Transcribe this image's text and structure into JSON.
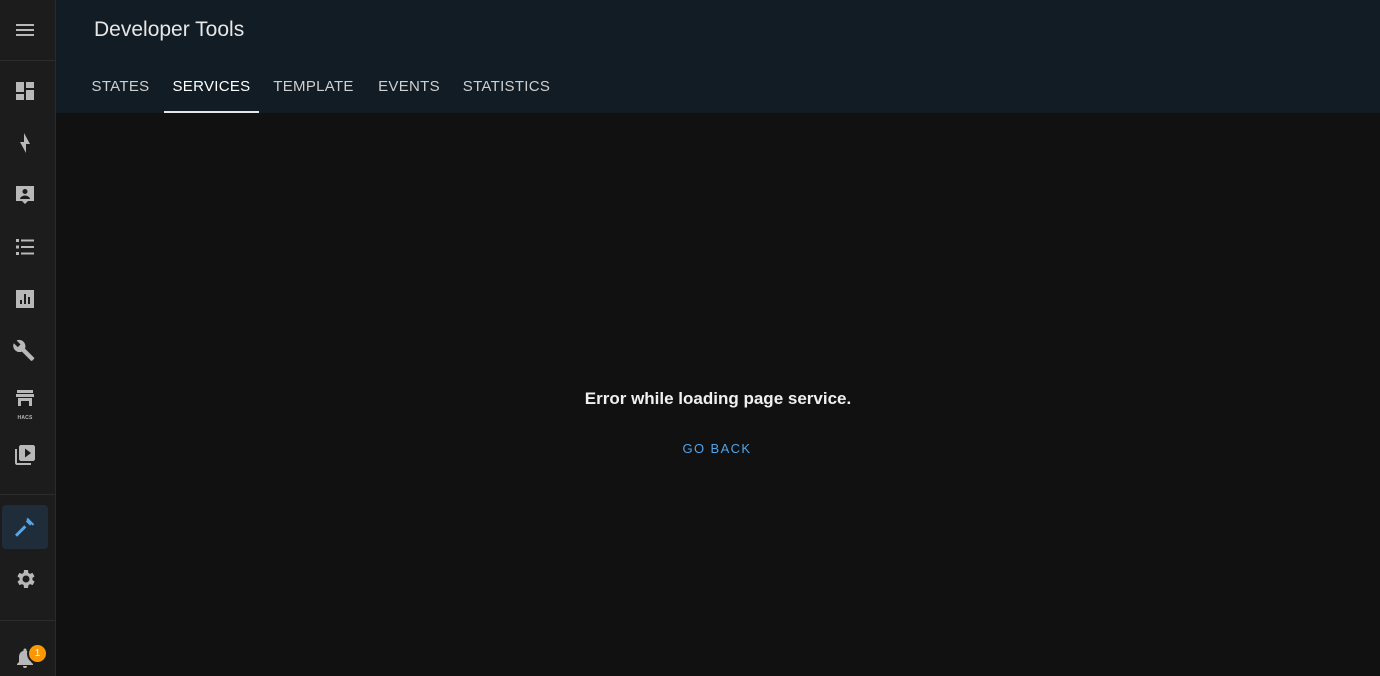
{
  "header": {
    "title": "Developer Tools"
  },
  "tabs": [
    {
      "label": "STATES",
      "active": false
    },
    {
      "label": "SERVICES",
      "active": true
    },
    {
      "label": "TEMPLATE",
      "active": false
    },
    {
      "label": "EVENTS",
      "active": false
    },
    {
      "label": "STATISTICS",
      "active": false
    }
  ],
  "sidebar": {
    "items": [
      {
        "icon": "menu-icon"
      },
      {
        "icon": "dashboard-icon"
      },
      {
        "icon": "lightning-icon"
      },
      {
        "icon": "logbook-icon"
      },
      {
        "icon": "list-icon"
      },
      {
        "icon": "history-chart-icon"
      },
      {
        "icon": "wrench-icon"
      },
      {
        "icon": "hacs-store-icon",
        "label": "HACS"
      },
      {
        "icon": "media-play-icon"
      },
      {
        "icon": "hammer-icon",
        "active": true
      },
      {
        "icon": "gear-icon"
      },
      {
        "icon": "bell-icon"
      }
    ],
    "notification_count": "1"
  },
  "content": {
    "error_message": "Error while loading page service.",
    "go_back_label": "GO BACK"
  },
  "colors": {
    "accent": "#55a6e6",
    "badge": "#ff9800",
    "header_bg": "#121c24",
    "content_bg": "#111111"
  }
}
